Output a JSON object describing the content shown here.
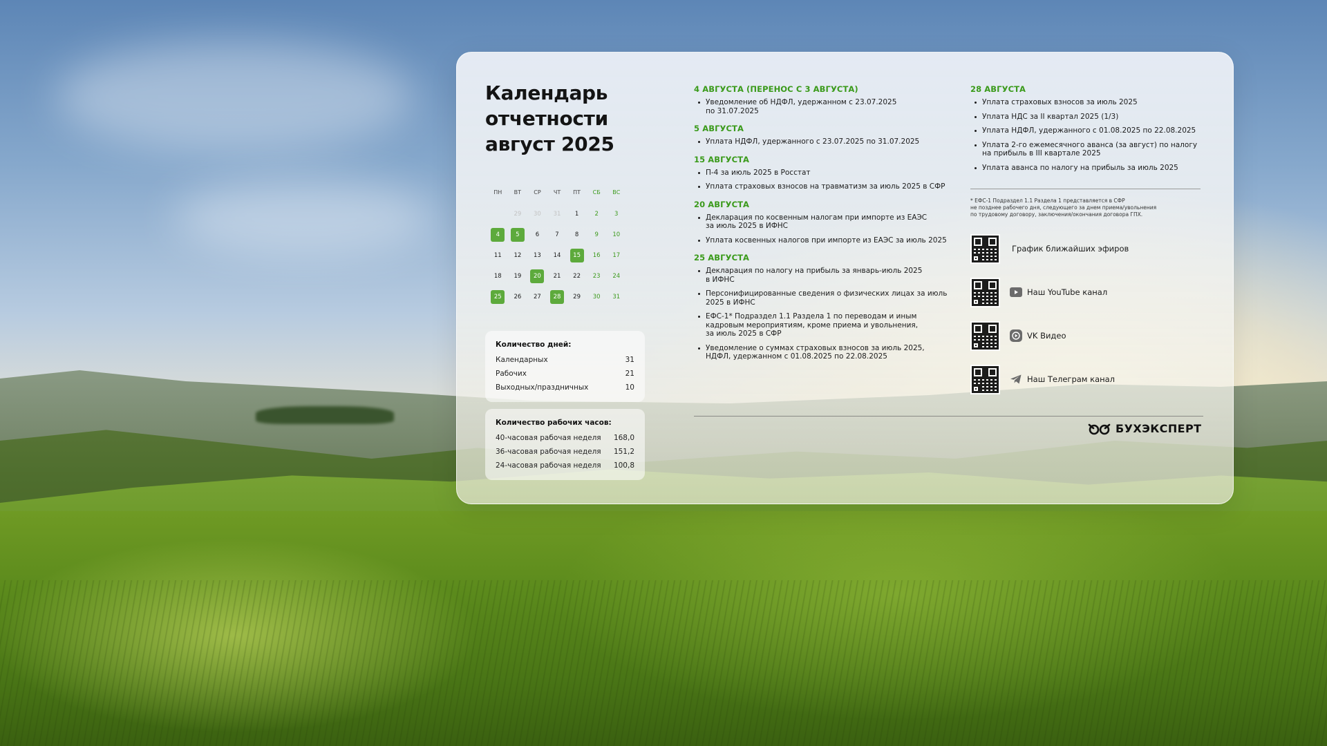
{
  "title": "Календарь\nотчетности\nавгуст 2025",
  "calendar": {
    "weekdays": [
      "ПН",
      "ВТ",
      "СР",
      "ЧТ",
      "ПТ",
      "СБ",
      "ВС"
    ],
    "weeks": [
      [
        {
          "d": "",
          "t": "empty"
        },
        {
          "d": "29",
          "t": "other"
        },
        {
          "d": "30",
          "t": "other"
        },
        {
          "d": "31",
          "t": "other"
        },
        {
          "d": "1",
          "t": "normal"
        },
        {
          "d": "2",
          "t": "weekend"
        },
        {
          "d": "3",
          "t": "weekend"
        }
      ],
      [
        {
          "d": "4",
          "t": "mark"
        },
        {
          "d": "5",
          "t": "mark"
        },
        {
          "d": "6",
          "t": "normal"
        },
        {
          "d": "7",
          "t": "normal"
        },
        {
          "d": "8",
          "t": "normal"
        },
        {
          "d": "9",
          "t": "weekend"
        },
        {
          "d": "10",
          "t": "weekend"
        }
      ],
      [
        {
          "d": "11",
          "t": "normal"
        },
        {
          "d": "12",
          "t": "normal"
        },
        {
          "d": "13",
          "t": "normal"
        },
        {
          "d": "14",
          "t": "normal"
        },
        {
          "d": "15",
          "t": "mark"
        },
        {
          "d": "16",
          "t": "weekend"
        },
        {
          "d": "17",
          "t": "weekend"
        }
      ],
      [
        {
          "d": "18",
          "t": "normal"
        },
        {
          "d": "19",
          "t": "normal"
        },
        {
          "d": "20",
          "t": "mark"
        },
        {
          "d": "21",
          "t": "normal"
        },
        {
          "d": "22",
          "t": "normal"
        },
        {
          "d": "23",
          "t": "weekend"
        },
        {
          "d": "24",
          "t": "weekend"
        }
      ],
      [
        {
          "d": "25",
          "t": "mark"
        },
        {
          "d": "26",
          "t": "normal"
        },
        {
          "d": "27",
          "t": "normal"
        },
        {
          "d": "28",
          "t": "mark"
        },
        {
          "d": "29",
          "t": "normal"
        },
        {
          "d": "30",
          "t": "weekend"
        },
        {
          "d": "31",
          "t": "weekend"
        }
      ]
    ]
  },
  "days_count": {
    "title": "Количество дней:",
    "rows": [
      {
        "label": "Календарных",
        "value": "31"
      },
      {
        "label": "Рабочих",
        "value": "21"
      },
      {
        "label": "Выходных/праздничных",
        "value": "10"
      }
    ]
  },
  "hours_count": {
    "title": "Количество рабочих часов:",
    "rows": [
      {
        "label": "40-часовая рабочая неделя",
        "value": "168,0"
      },
      {
        "label": "36-часовая рабочая неделя",
        "value": "151,2"
      },
      {
        "label": "24-часовая рабочая неделя",
        "value": "100,8"
      }
    ]
  },
  "column1": [
    {
      "title": "4 АВГУСТА (ПЕРЕНОС С 3 АВГУСТА)",
      "items": [
        "Уведомление об НДФЛ, удержанном с 23.07.2025\nпо 31.07.2025"
      ]
    },
    {
      "title": "5 АВГУСТА",
      "items": [
        "Уплата НДФЛ, удержанного с 23.07.2025 по 31.07.2025"
      ]
    },
    {
      "title": "15 АВГУСТА",
      "items": [
        "П-4 за июль 2025 в Росстат",
        "Уплата страховых взносов на травматизм за июль 2025 в СФР"
      ]
    },
    {
      "title": "20 АВГУСТА",
      "items": [
        "Декларация по косвенным налогам при импорте из ЕАЭС\nза июль 2025  в ИФНС",
        "Уплата косвенных налогов при импорте из ЕАЭС за июль 2025"
      ]
    },
    {
      "title": "25 АВГУСТА",
      "items": [
        "Декларация по налогу на прибыль за январь-июль 2025\nв ИФНС",
        "Персонифицированные сведения о физических лицах за июль\n2025 в ИФНС",
        "ЕФС-1* Подраздел 1.1 Раздела 1 по переводам и иным\nкадровым мероприятиям, кроме приема и увольнения,\nза июль 2025 в СФР",
        "Уведомление о суммах страховых взносов за июль 2025,\nНДФЛ, удержанном с 01.08.2025 по 22.08.2025"
      ]
    }
  ],
  "column2": [
    {
      "title": "28 АВГУСТА",
      "items": [
        "Уплата страховых взносов за июль 2025",
        "Уплата НДС за II квартал 2025 (1/3)",
        "Уплата НДФЛ, удержанного с 01.08.2025 по 22.08.2025",
        "Уплата 2-го ежемесячного аванса (за август) по налогу\nна прибыль в III квартале 2025",
        "Уплата аванса по налогу на прибыль за июль 2025"
      ]
    }
  ],
  "footnote": "* ЕФС-1 Подраздел 1.1 Раздела 1 представляется в СФР\nне позднее рабочего дня, следующего за днем приема/увольнения\nпо трудовому договору, заключения/окончания договора ГПХ.",
  "links": [
    {
      "label": "График ближайших эфиров",
      "icon": "none"
    },
    {
      "label": "Наш YouTube канал",
      "icon": "youtube-icon"
    },
    {
      "label": "VK Видео",
      "icon": "vk-video-icon"
    },
    {
      "label": "Наш Телеграм канал",
      "icon": "telegram-icon"
    }
  ],
  "brand": "БУХЭКСПЕРТ",
  "colors": {
    "accent_green": "#3a9a1a",
    "marked_day": "#5daa3c",
    "weekend_day": "#3c9a1c",
    "other_month_day": "#c3c3c3"
  }
}
